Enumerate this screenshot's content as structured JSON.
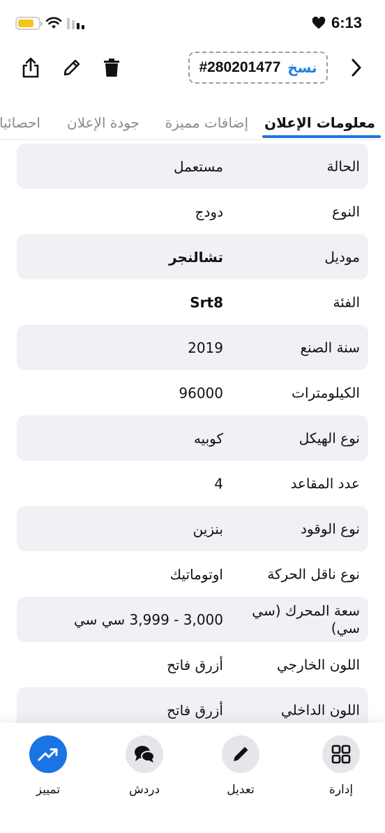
{
  "status_bar": {
    "time": "6:13"
  },
  "header": {
    "ad_id": "#280201477",
    "copy_label": "نسخ"
  },
  "tabs": [
    {
      "label": "معلومات الإعلان",
      "active": true
    },
    {
      "label": "إضافات مميزة",
      "active": false
    },
    {
      "label": "جودة الإعلان",
      "active": false
    },
    {
      "label": "احصائيات",
      "active": false
    }
  ],
  "details": [
    {
      "label": "الحالة",
      "value": "مستعمل",
      "bold": false
    },
    {
      "label": "النوع",
      "value": "دودج",
      "bold": false
    },
    {
      "label": "موديل",
      "value": "تشالنجر",
      "bold": true
    },
    {
      "label": "الفئة",
      "value": "Srt8",
      "bold": true
    },
    {
      "label": "سنة الصنع",
      "value": "2019",
      "bold": false
    },
    {
      "label": "الكيلومترات",
      "value": "96000",
      "bold": false
    },
    {
      "label": "نوع الهيكل",
      "value": "كوبيه",
      "bold": false
    },
    {
      "label": "عدد المقاعد",
      "value": "4",
      "bold": false
    },
    {
      "label": "نوع الوقود",
      "value": "بنزين",
      "bold": false
    },
    {
      "label": "نوع ناقل الحركة",
      "value": "اوتوماتيك",
      "bold": false
    },
    {
      "label": "سعة المحرك (سي سي)",
      "value": "3,000 - 3,999 سي سي",
      "bold": false
    },
    {
      "label": "اللون الخارجي",
      "value": "أزرق فاتح",
      "bold": false
    },
    {
      "label": "اللون الداخلي",
      "value": "أزرق فاتح",
      "bold": false
    }
  ],
  "bottom_nav": {
    "manage": "إدارة",
    "edit": "تعديل",
    "chat": "دردش",
    "promote": "تمييز"
  },
  "colors": {
    "accent": "#1b74e4",
    "row_shade": "#f1f1f5",
    "battery": "#f5c518"
  }
}
